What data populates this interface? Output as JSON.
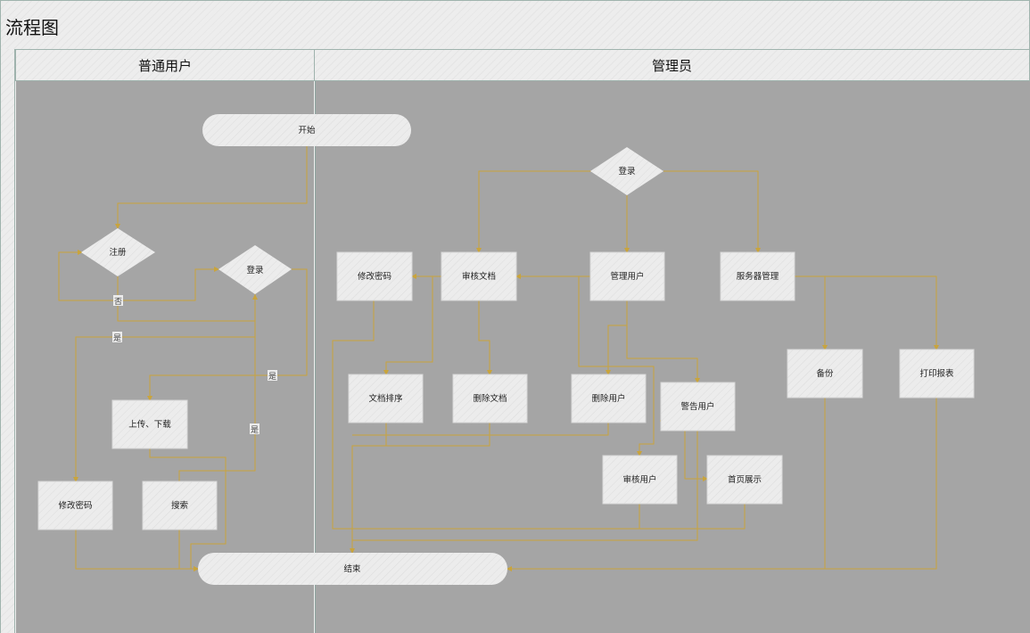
{
  "diagram": {
    "title": "流程图",
    "lanes": [
      {
        "id": "user",
        "label": "普通用户"
      },
      {
        "id": "admin",
        "label": "管理员"
      }
    ],
    "nodes": {
      "start": "开始",
      "register": "注册",
      "user_login": "登录",
      "upload_download": "上传、下载",
      "user_change_pw": "修改密码",
      "search": "搜索",
      "end": "结束",
      "admin_login": "登录",
      "admin_change_pw": "修改密码",
      "review_docs": "审核文档",
      "manage_users": "管理用户",
      "server_mgmt": "服务器管理",
      "sort_docs": "文档排序",
      "delete_docs": "删除文档",
      "delete_user": "删除用户",
      "warn_user": "警告用户",
      "review_user": "审核用户",
      "home_display": "首页展示",
      "backup": "备份",
      "print_report": "打印报表"
    },
    "edge_labels": {
      "no": "否",
      "yes": "是"
    },
    "colors": {
      "connector": "#c9a43c",
      "lane_fill": "#a5a5a5",
      "node_fill": "#ececec",
      "border": "#9fb3ad"
    }
  }
}
